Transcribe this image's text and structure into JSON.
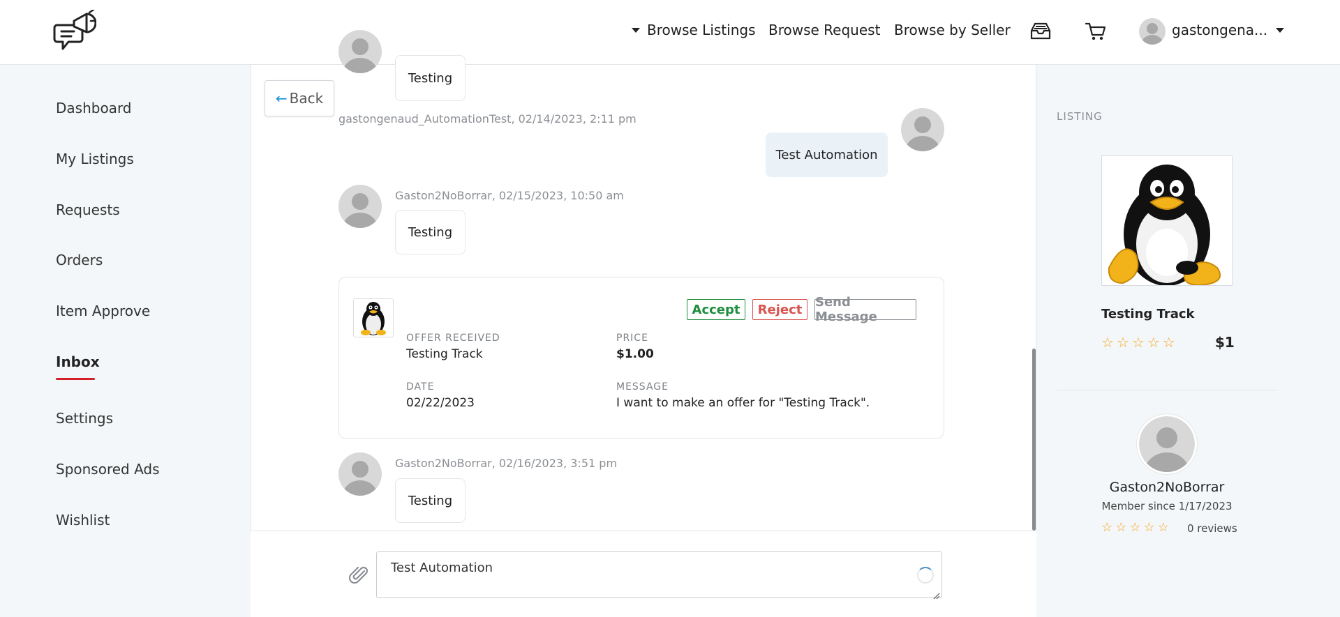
{
  "header": {
    "nav": {
      "browse_listings": "Browse Listings",
      "browse_request": "Browse Request",
      "browse_by_seller": "Browse by Seller"
    },
    "username": "gastongena..."
  },
  "sidebar": {
    "items": [
      {
        "label": "Dashboard"
      },
      {
        "label": "My Listings"
      },
      {
        "label": "Requests"
      },
      {
        "label": "Orders"
      },
      {
        "label": "Item Approve"
      },
      {
        "label": "Inbox",
        "active": true
      },
      {
        "label": "Settings"
      },
      {
        "label": "Sponsored Ads"
      },
      {
        "label": "Wishlist"
      }
    ]
  },
  "chat": {
    "back_label": "Back",
    "messages": [
      {
        "text": "Testing"
      },
      {
        "meta": "gastongenaud_AutomationTest, 02/14/2023, 2:11 pm",
        "text": "Test Automation",
        "own": true
      },
      {
        "meta": "Gaston2NoBorrar, 02/15/2023, 10:50 am",
        "text": "Testing"
      },
      {
        "meta": "Gaston2NoBorrar, 02/16/2023, 3:51 pm",
        "text": "Testing"
      }
    ],
    "offer": {
      "accept": "Accept",
      "reject": "Reject",
      "send_message": "Send Message",
      "offer_received_label": "OFFER RECEIVED",
      "offer_received_value": "Testing Track",
      "price_label": "PRICE",
      "price_value": "$1.00",
      "date_label": "DATE",
      "date_value": "02/22/2023",
      "message_label": "MESSAGE",
      "message_value": "I want to make an offer for \"Testing Track\"."
    },
    "composer_value": "Test Automation"
  },
  "listing": {
    "heading": "LISTING",
    "title": "Testing Track",
    "price": "$1",
    "rating": 0
  },
  "seller": {
    "name": "Gaston2NoBorrar",
    "member_since": "Member since 1/17/2023",
    "reviews": "0 reviews",
    "rating": 0
  },
  "colors": {
    "accent_red": "#d32029",
    "accept_green": "#1e8e3e",
    "reject_red": "#d9534f",
    "neutral_gray": "#8b8f94",
    "star_orange": "#f5a623"
  }
}
